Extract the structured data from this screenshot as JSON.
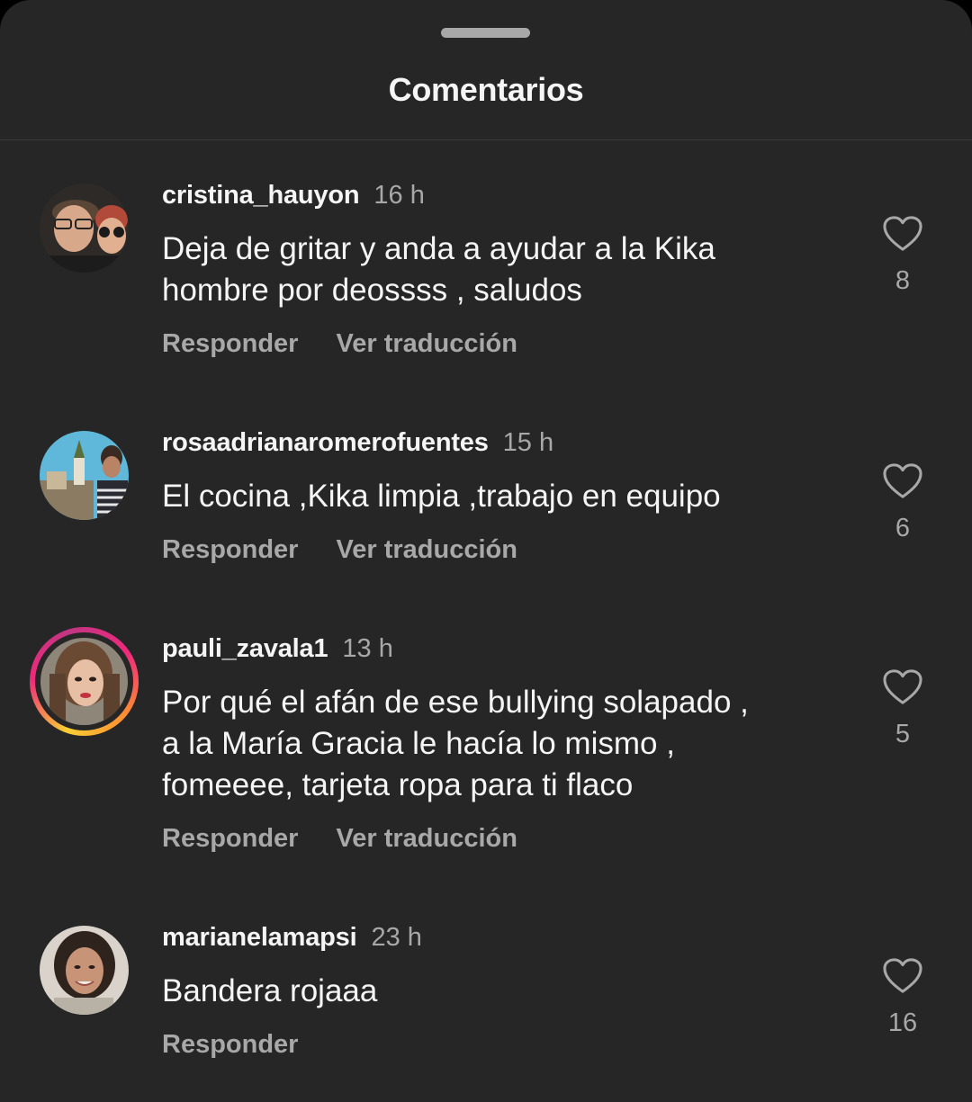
{
  "sheet": {
    "title": "Comentarios"
  },
  "comments": [
    {
      "username": "cristina_hauyon",
      "time": "16 h",
      "text": "Deja de gritar y anda a ayudar a la Kika\nhombre por deossss , saludos",
      "reply_label": "Responder",
      "translate_label": "Ver traducción",
      "likes": "8"
    },
    {
      "username": "rosaadrianaromerofuentes",
      "time": "15 h",
      "text": "El cocina ,Kika limpia ,trabajo en equipo",
      "reply_label": "Responder",
      "translate_label": "Ver traducción",
      "likes": "6"
    },
    {
      "username": "pauli_zavala1",
      "time": "13 h",
      "text": "Por qué el afán de ese bullying solapado ,\na la María Gracia le hacía lo mismo ,\nfomeeee, tarjeta ropa para ti flaco",
      "reply_label": "Responder",
      "translate_label": "Ver traducción",
      "likes": "5",
      "has_story_ring": true
    },
    {
      "username": "marianelamapsi",
      "time": "23 h",
      "text": "Bandera rojaaa",
      "reply_label": "Responder",
      "likes": "16"
    }
  ],
  "colors": {
    "background": "#262626",
    "primary_text": "#f5f5f5",
    "secondary_text": "#a8a8a8",
    "story_ring": [
      "#f9ce34",
      "#ee2a7b",
      "#c13584"
    ]
  },
  "icons": {
    "like": "heart-outline-icon"
  }
}
